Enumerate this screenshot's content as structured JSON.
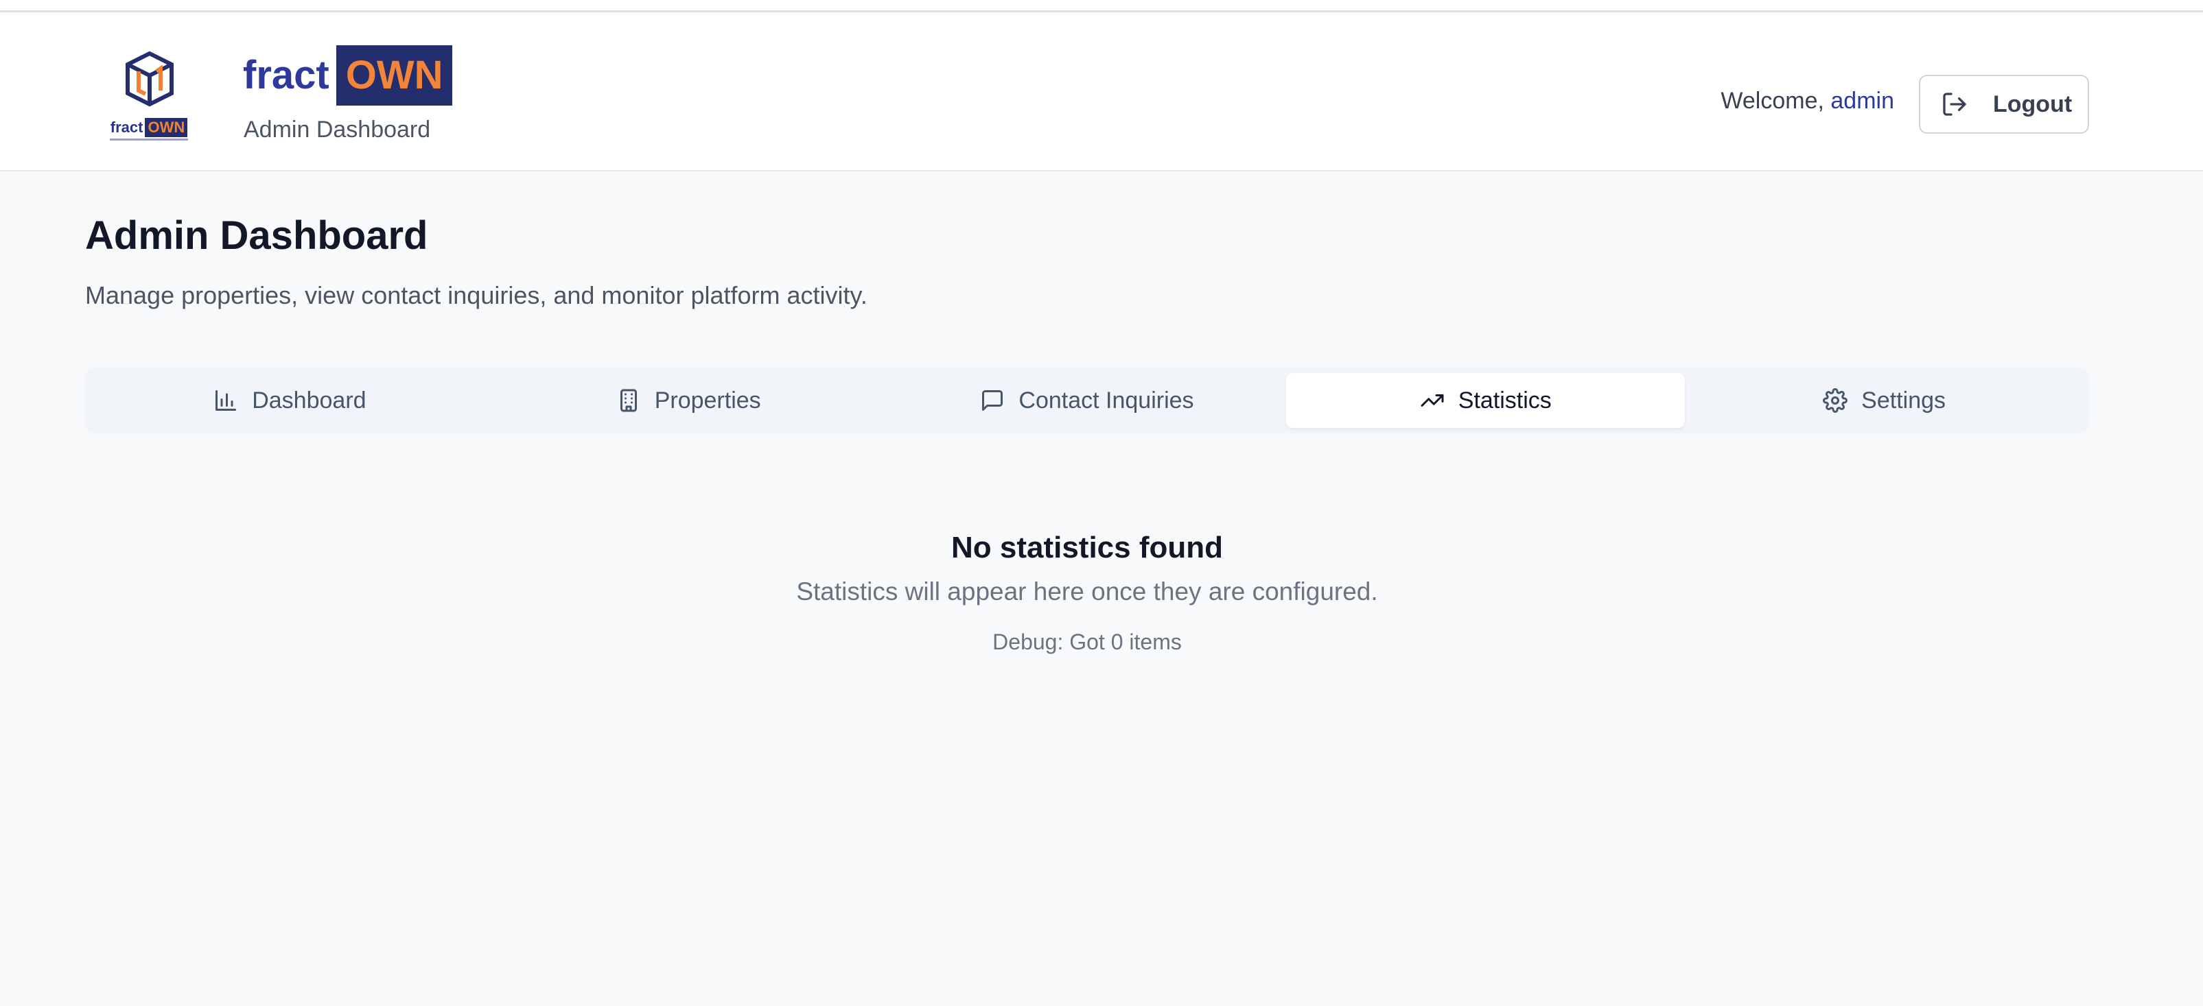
{
  "header": {
    "logo_icon": "fractown-cube-logo",
    "logo_mini_text_fract": "fract",
    "logo_mini_text_own": "OWN",
    "brand_fract": "fract",
    "brand_own": "OWN",
    "brand_subtitle": "Admin Dashboard",
    "welcome_prefix": "Welcome,",
    "welcome_user": "admin",
    "logout_label": "Logout",
    "logout_icon": "logout-icon"
  },
  "page": {
    "title": "Admin Dashboard",
    "subtitle": "Manage properties, view contact inquiries, and monitor platform activity."
  },
  "tabs": [
    {
      "label": "Dashboard",
      "icon": "bar-chart-icon",
      "active": false
    },
    {
      "label": "Properties",
      "icon": "building-icon",
      "active": false
    },
    {
      "label": "Contact Inquiries",
      "icon": "message-square-icon",
      "active": false
    },
    {
      "label": "Statistics",
      "icon": "trending-up-icon",
      "active": true
    },
    {
      "label": "Settings",
      "icon": "gear-icon",
      "active": false
    }
  ],
  "empty_state": {
    "title": "No statistics found",
    "message": "Statistics will appear here once they are configured.",
    "debug": "Debug: Got 0 items"
  },
  "colors": {
    "brand_blue": "#2d3a9c",
    "brand_navy": "#242e6c",
    "brand_orange": "#f2853a",
    "background": "#f8f9fb"
  }
}
